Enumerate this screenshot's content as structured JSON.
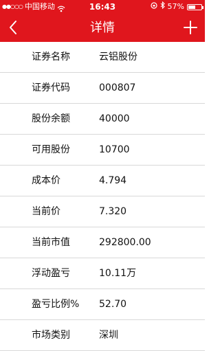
{
  "status_bar": {
    "signal": "●●○○○",
    "carrier": "中国移动",
    "time": "16:43",
    "battery_text": "57%",
    "battery_level": 0.57
  },
  "nav": {
    "title": "详情",
    "back_icon": "chevron-left-icon",
    "add_icon": "plus-icon"
  },
  "details": [
    {
      "label": "证券名称",
      "value": "云铝股份"
    },
    {
      "label": "证券代码",
      "value": "000807"
    },
    {
      "label": "股份余额",
      "value": "40000"
    },
    {
      "label": "可用股份",
      "value": "10700"
    },
    {
      "label": "成本价",
      "value": "4.794"
    },
    {
      "label": "当前价",
      "value": "7.320"
    },
    {
      "label": "当前市值",
      "value": "292800.00"
    },
    {
      "label": "浮动盈亏",
      "value": "10.11万"
    },
    {
      "label": "盈亏比例%",
      "value": "52.70"
    },
    {
      "label": "市场类别",
      "value": "深圳"
    }
  ],
  "colors": {
    "header_bg": "#e0161d",
    "divider": "#d8d8d8"
  }
}
